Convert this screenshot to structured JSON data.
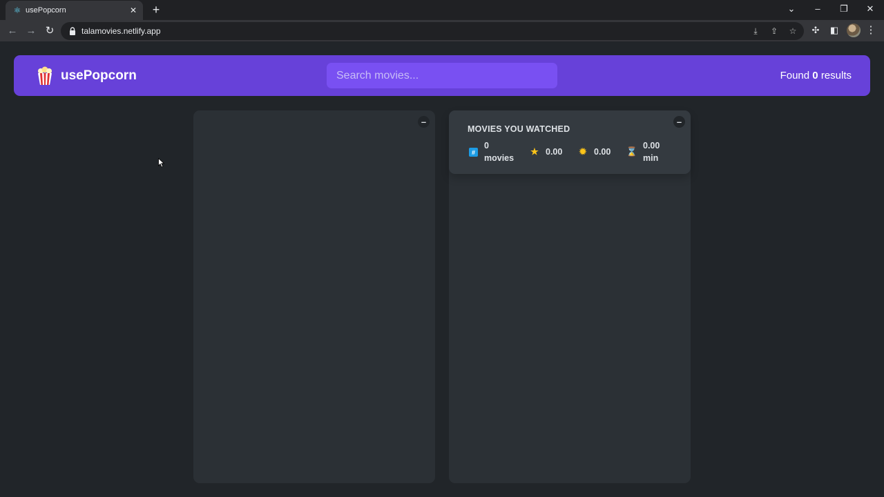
{
  "browser": {
    "tab_title": "usePopcorn",
    "url": "talamovies.netlify.app"
  },
  "app": {
    "logo_text": "usePopcorn",
    "search_placeholder": "Search movies...",
    "results_prefix": "Found",
    "results_count": "0",
    "results_suffix": "results",
    "toggle_label": "–"
  },
  "summary": {
    "heading": "MOVIES YOU WATCHED",
    "movies_count": "0",
    "movies_label": "movies",
    "imdb_rating": "0.00",
    "user_rating": "0.00",
    "runtime": "0.00",
    "runtime_unit": "min"
  },
  "colors": {
    "primary": "#6741d9",
    "primary_light": "#7950f2",
    "background": "#212529",
    "box": "#2b3035",
    "summary": "#343a40"
  }
}
